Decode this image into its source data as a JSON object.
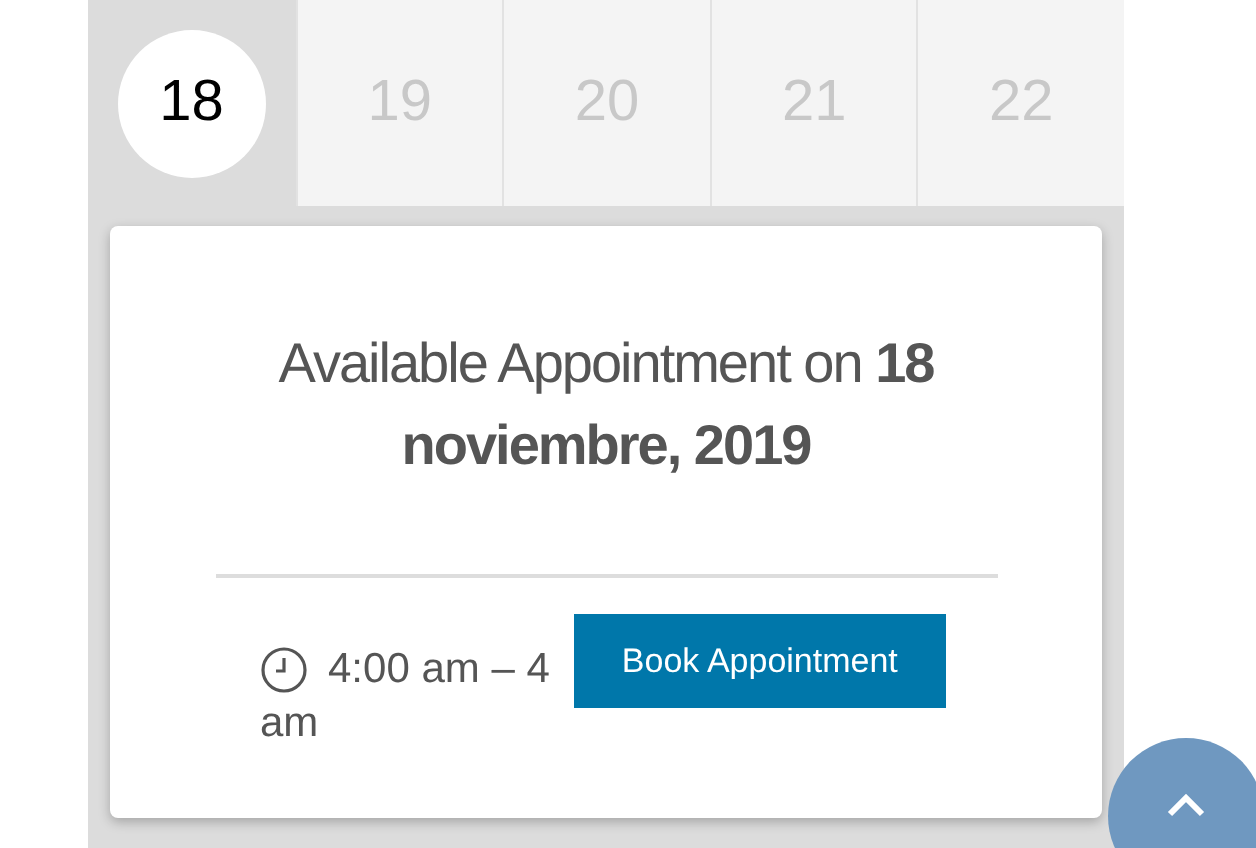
{
  "days": [
    {
      "label": "18",
      "selected": true
    },
    {
      "label": "19",
      "selected": false
    },
    {
      "label": "20",
      "selected": false
    },
    {
      "label": "21",
      "selected": false
    },
    {
      "label": "22",
      "selected": false
    }
  ],
  "card": {
    "heading": "Available Appointment on **18 noviembre, 2019**",
    "time_line_1": "4:00 am – 4",
    "time_line_2": "am",
    "button": "Book Appointment"
  }
}
